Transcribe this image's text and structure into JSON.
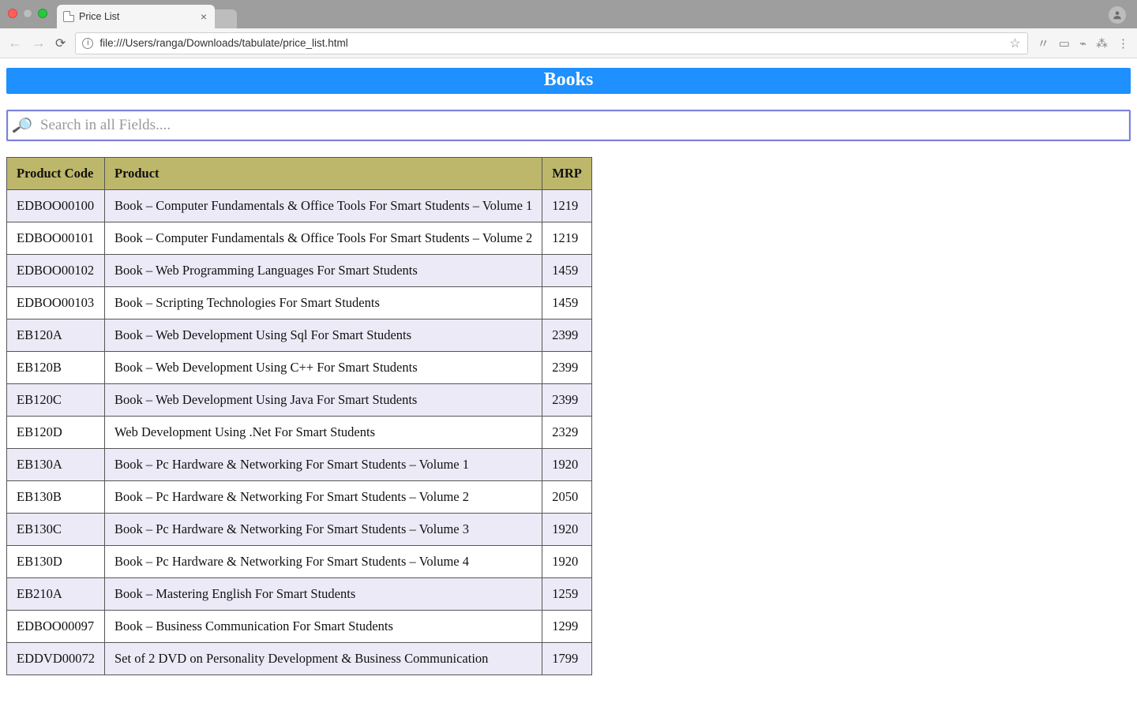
{
  "chrome": {
    "tab_title": "Price List",
    "url": "file:///Users/ranga/Downloads/tabulate/price_list.html"
  },
  "page": {
    "title": "Books",
    "search_placeholder": "Search in all Fields....",
    "columns": [
      "Product Code",
      "Product",
      "MRP"
    ],
    "rows": [
      {
        "code": "EDBOO00100",
        "product": "Book – Computer Fundamentals & Office Tools For Smart Students – Volume 1",
        "mrp": "1219"
      },
      {
        "code": "EDBOO00101",
        "product": "Book – Computer Fundamentals & Office Tools For Smart Students – Volume 2",
        "mrp": "1219"
      },
      {
        "code": "EDBOO00102",
        "product": "Book – Web Programming Languages For Smart Students",
        "mrp": "1459"
      },
      {
        "code": "EDBOO00103",
        "product": "Book – Scripting Technologies For Smart Students",
        "mrp": "1459"
      },
      {
        "code": "EB120A",
        "product": "Book – Web Development Using Sql For Smart Students",
        "mrp": "2399"
      },
      {
        "code": "EB120B",
        "product": "Book – Web Development Using C++ For Smart Students",
        "mrp": "2399"
      },
      {
        "code": "EB120C",
        "product": "Book – Web Development Using Java For Smart Students",
        "mrp": "2399"
      },
      {
        "code": "EB120D",
        "product": "Web Development Using .Net For Smart Students",
        "mrp": "2329"
      },
      {
        "code": "EB130A",
        "product": "Book – Pc Hardware & Networking For Smart Students – Volume 1",
        "mrp": "1920"
      },
      {
        "code": "EB130B",
        "product": "Book – Pc Hardware & Networking For Smart Students – Volume 2",
        "mrp": "2050"
      },
      {
        "code": "EB130C",
        "product": "Book – Pc Hardware & Networking For Smart Students – Volume 3",
        "mrp": "1920"
      },
      {
        "code": "EB130D",
        "product": "Book – Pc Hardware & Networking For Smart Students – Volume 4",
        "mrp": "1920"
      },
      {
        "code": "EB210A",
        "product": "Book – Mastering English For Smart Students",
        "mrp": "1259"
      },
      {
        "code": "EDBOO00097",
        "product": "Book – Business Communication For Smart Students",
        "mrp": "1299"
      },
      {
        "code": "EDDVD00072",
        "product": "Set of 2 DVD on Personality Development & Business Communication",
        "mrp": "1799"
      }
    ]
  }
}
